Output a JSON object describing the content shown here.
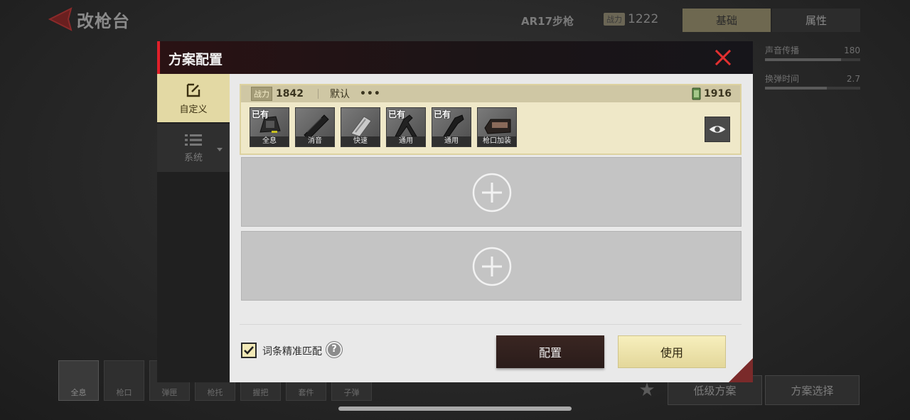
{
  "background": {
    "page_title": "改枪台",
    "weapon_name": "AR17步枪",
    "power_tag": "战力",
    "power_value": "1222",
    "tabs": [
      "基础",
      "属性"
    ],
    "stats": [
      {
        "label": "声音传播",
        "value": "180",
        "level": 0.8
      },
      {
        "label": "换弹时间",
        "value": "2.7",
        "level": 0.65
      }
    ],
    "slots": [
      "全息",
      "枪口",
      "弹匣",
      "枪托",
      "握把",
      "套件",
      "子弹"
    ],
    "buttons": {
      "low_plan": "低级方案",
      "plan_select": "方案选择"
    }
  },
  "modal": {
    "title": "方案配置",
    "nav": {
      "custom": "自定义",
      "system": "系统"
    },
    "plan": {
      "power_tag": "战力",
      "power": "1842",
      "name": "默认",
      "more": "•••",
      "price": "1916",
      "parts": [
        {
          "label": "全息",
          "owned": "已有",
          "icon": "holo-sight-icon"
        },
        {
          "label": "消音",
          "owned": "",
          "icon": "suppressor-icon"
        },
        {
          "label": "快速",
          "owned": "",
          "icon": "quick-mag-icon"
        },
        {
          "label": "通用",
          "owned": "已有",
          "icon": "stock-icon"
        },
        {
          "label": "通用",
          "owned": "已有",
          "icon": "grip-icon"
        },
        {
          "label": "枪口加装",
          "owned": "",
          "icon": "muzzle-kit-icon"
        }
      ]
    },
    "precise_match_label": "词条精准匹配",
    "precise_match_checked": true,
    "help": "?",
    "config_button": "配置",
    "use_button": "使用"
  },
  "colors": {
    "accent_red": "#e0202a",
    "selected_gold": "#e3d9a4",
    "use_button": "#f0e6b0"
  }
}
